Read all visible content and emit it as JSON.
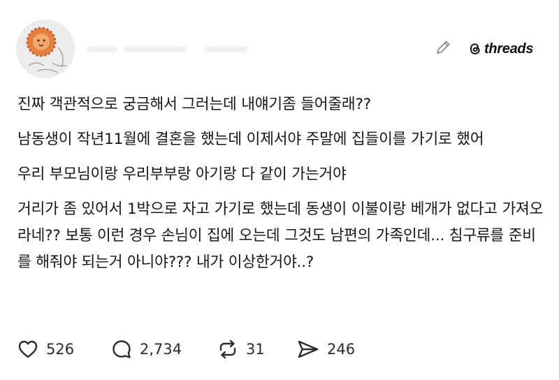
{
  "header": {
    "username": "",
    "brand_name": "threads",
    "icons": {
      "edit": "pencil-icon",
      "brand": "threads-logo-icon"
    }
  },
  "post": {
    "paragraphs": [
      "진짜 객관적으로 궁금해서 그러는데 내얘기좀 들어줄래??",
      "남동생이 작년11월에 결혼을 했는데 이제서야 주말에 집들이를 가기로 했어",
      "우리 부모님이랑 우리부부랑 아기랑 다 같이 가는거야",
      "거리가 좀 있어서 1박으로 자고 가기로 했는데 동생이 이불이랑 베개가 없다고 가져오라네?? 보통 이런 경우 손님이 집에 오는데 그것도 남편의 가족인데... 침구류를 준비를 해줘야 되는거 아니야??? 내가 이상한거야..?"
    ]
  },
  "actions": {
    "like": {
      "icon": "heart-icon",
      "count": "526"
    },
    "reply": {
      "icon": "comment-icon",
      "count": "2,734"
    },
    "repost": {
      "icon": "repost-icon",
      "count": "31"
    },
    "share": {
      "icon": "share-icon",
      "count": "246"
    }
  },
  "colors": {
    "text": "#161616",
    "icon": "#2b2b2b",
    "background": "#ffffff",
    "avatar_accent": "#e07a3f"
  }
}
